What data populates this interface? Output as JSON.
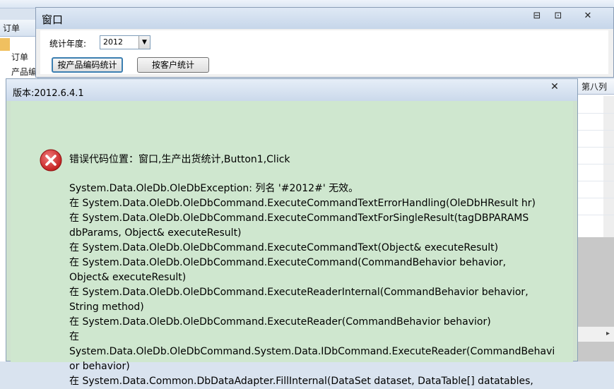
{
  "background": {
    "left_header": "订单",
    "left_items": [
      "订单",
      "产品编"
    ],
    "right_header": "第八列",
    "scroll_right_glyph": "▸"
  },
  "window": {
    "title": "窗口",
    "minimize_glyph": "⊟",
    "maximize_glyph": "⊡",
    "close_glyph": "✕",
    "year_label": "统计年度:",
    "year_value": "2012",
    "year_arrow": "▼",
    "btn_by_product": "按产品编码统计",
    "btn_by_customer": "按客户统计"
  },
  "dialog": {
    "title": "版本:2012.6.4.1",
    "close_glyph": "✕",
    "icon": "error-icon",
    "location": "错误代码位置：窗口,生产出货统计,Button1,Click",
    "trace": [
      "System.Data.OleDb.OleDbException: 列名 '#2012#' 无效。",
      "   在 System.Data.OleDb.OleDbCommand.ExecuteCommandTextErrorHandling(OleDbHResult hr)",
      "   在 System.Data.OleDb.OleDbCommand.ExecuteCommandTextForSingleResult(tagDBPARAMS",
      "dbParams, Object& executeResult)",
      "   在 System.Data.OleDb.OleDbCommand.ExecuteCommandText(Object& executeResult)",
      "   在 System.Data.OleDb.OleDbCommand.ExecuteCommand(CommandBehavior behavior,",
      "Object& executeResult)",
      "   在 System.Data.OleDb.OleDbCommand.ExecuteReaderInternal(CommandBehavior behavior,",
      "String method)",
      "   在 System.Data.OleDb.OleDbCommand.ExecuteReader(CommandBehavior behavior)",
      "   在",
      "System.Data.OleDb.OleDbCommand.System.Data.IDbCommand.ExecuteReader(CommandBehavi",
      "or behavior)",
      "   在 System.Data.Common.DbDataAdapter.FillInternal(DataSet dataset, DataTable[] datatables,"
    ]
  },
  "colors": {
    "dialog_bg": "#cfe7cf",
    "error_red": "#d42b2b",
    "primary_button_border": "#3c7fb1"
  }
}
